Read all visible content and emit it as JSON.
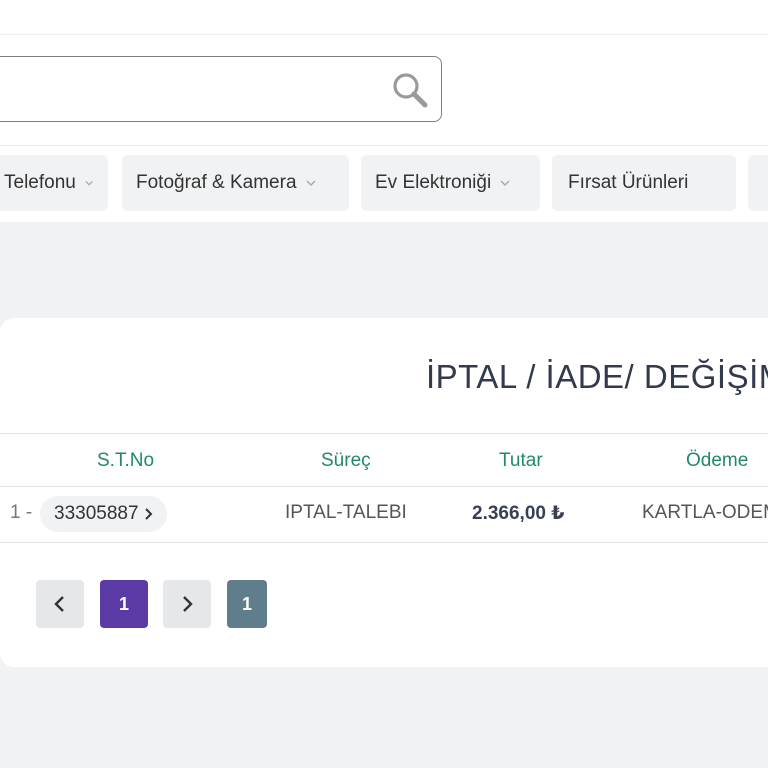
{
  "search": {
    "value": "",
    "placeholder": ""
  },
  "nav": {
    "items": [
      {
        "label": "Telefonu",
        "has_dropdown": true
      },
      {
        "label": "Fotoğraf & Kamera",
        "has_dropdown": true
      },
      {
        "label": "Ev Elektroniği",
        "has_dropdown": true
      },
      {
        "label": "Fırsat Ürünleri",
        "has_dropdown": false
      }
    ]
  },
  "page": {
    "title": "İPTAL / İADE/ DEĞİŞİM"
  },
  "table": {
    "headers": [
      "S.T.No",
      "Süreç",
      "Tutar",
      "Ödeme"
    ],
    "rows": [
      {
        "index": "1 -",
        "order_no": "33305887",
        "process": "IPTAL-TALEBI",
        "amount": "2.366,00 ₺",
        "payment": "KARTLA-ODEME"
      }
    ]
  },
  "pagination": {
    "prev_label": "‹",
    "next_label": "›",
    "current_page": "1",
    "total_pages": "1"
  },
  "colors": {
    "accent_header": "#1f8a6b",
    "active_page": "#5b3aa6",
    "total_page": "#5f7d8a",
    "page_bg": "#f1f2f4"
  }
}
